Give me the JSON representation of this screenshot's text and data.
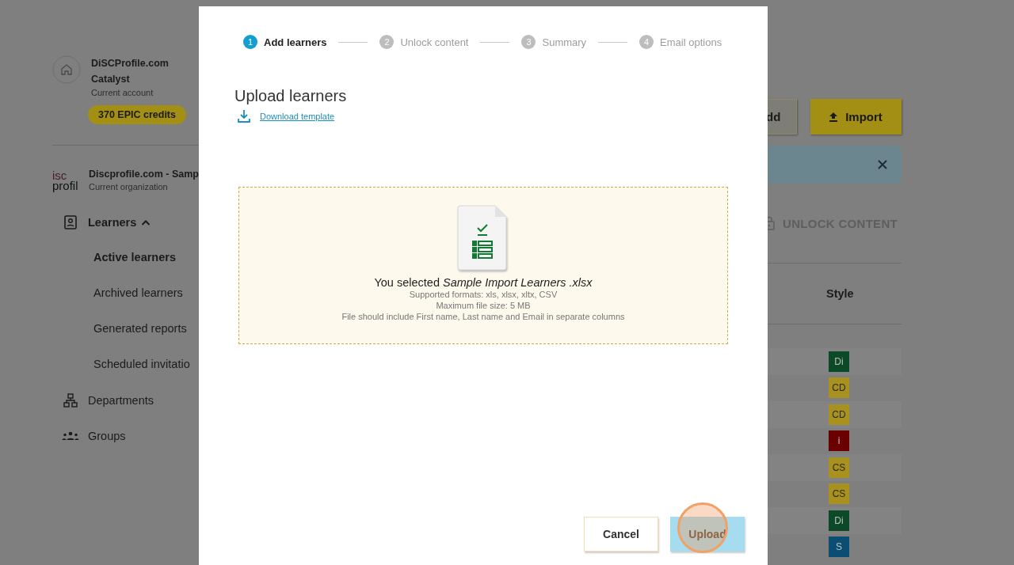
{
  "sidebar": {
    "account": {
      "name": "DiSCProfile.com",
      "plan": "Catalyst",
      "caption": "Current account",
      "credits": "370 EPIC credits"
    },
    "organization": {
      "logo": [
        "isc",
        "profil"
      ],
      "name": "Discprofile.com - Samp",
      "caption": "Current organization"
    },
    "nav": [
      {
        "label": "Learners",
        "expanded": true,
        "children": [
          {
            "label": "Active learners",
            "selected": true
          },
          {
            "label": "Archived learners",
            "selected": false
          },
          {
            "label": "Generated reports",
            "selected": false
          },
          {
            "label": "Scheduled invitatio",
            "selected": false
          }
        ]
      },
      {
        "label": "Departments"
      },
      {
        "label": "Groups"
      }
    ]
  },
  "main": {
    "buttons": [
      {
        "kind": "add",
        "label": "dd"
      },
      {
        "kind": "import",
        "label": "Import"
      }
    ],
    "banner": {
      "closable": true
    },
    "unlock": {
      "label": "UNLOCK CONTENT",
      "disabled": true
    },
    "table": {
      "columns": [
        "Style"
      ],
      "rows": [
        {
          "style": "Di",
          "color": "#0c4a27"
        },
        {
          "style": "CD",
          "color": "#a8911f"
        },
        {
          "style": "CD",
          "color": "#a8911f"
        },
        {
          "style": "i",
          "color": "#6a0000"
        },
        {
          "style": "CS",
          "color": "#a8911f"
        },
        {
          "style": "CS",
          "color": "#a8911f"
        },
        {
          "style": "Di",
          "color": "#0c4a27"
        },
        {
          "style": "S",
          "color": "#0c4e73"
        }
      ]
    }
  },
  "modal": {
    "steps": [
      {
        "number": "1",
        "label": "Add learners",
        "selected": true
      },
      {
        "number": "2",
        "label": "Unlock content",
        "selected": false
      },
      {
        "number": "3",
        "label": "Summary",
        "selected": false
      },
      {
        "number": "4",
        "label": "Email options",
        "selected": false
      }
    ],
    "title": "Upload learners",
    "download_link": "Download template",
    "dropzone": {
      "message": "You selected *Sample Import Learners .xlsx*",
      "hints": [
        "Supported formats: xls, xlsx, xltx, CSV",
        "Maximum file size: 5 MB",
        "File should include First name, Last name and Email in separate columns"
      ]
    },
    "buttons": [
      {
        "kind": "cancel",
        "label": "Cancel"
      },
      {
        "kind": "upload",
        "label": "Upload",
        "clicked": true
      }
    ]
  }
}
